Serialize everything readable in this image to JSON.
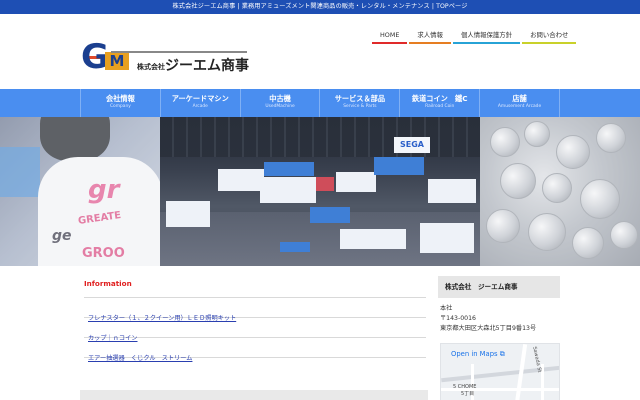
{
  "topbar": {
    "text": "株式会社ジーエム商事 | 業務用アミューズメント関連商品の販売・レンタル・メンテナンス | TOPページ"
  },
  "logo": {
    "mark": "GM",
    "company_prefix": "株式会社",
    "company_name": "ジーエム商事"
  },
  "topnav": [
    {
      "label": "HOME"
    },
    {
      "label": "求人情報"
    },
    {
      "label": "個人情報保護方針"
    },
    {
      "label": "お問い合わせ"
    }
  ],
  "mainnav": [
    {
      "label": "会社情報",
      "sub": "Company"
    },
    {
      "label": "アーケードマシン",
      "sub": "Arcade"
    },
    {
      "label": "中古機",
      "sub": "UsedMachine"
    },
    {
      "label": "サービス＆部品",
      "sub": "Service & Parts"
    },
    {
      "label": "鉄道コイン　鐵C",
      "sub": "Railroad Coin"
    },
    {
      "label": "店舗",
      "sub": "Amusement Arcade"
    }
  ],
  "hero": {
    "shirt_print_1": "gr",
    "shirt_print_2": "GREATE",
    "shirt_print_3": "GROO",
    "booth_sign": "SEGA"
  },
  "information": {
    "title": "Information",
    "items": [
      {
        "label": "フレナスター（１、２クイーン用）ＬＥＤ照明キット"
      },
      {
        "label": "カップ｜ｎコイン"
      },
      {
        "label": "エアー抽選器　くじクル　ストリーム"
      }
    ]
  },
  "sidebar": {
    "title": "株式会社　ジーエム商事",
    "lines": [
      "本社",
      "〒143-0016",
      "東京都大田区大森北5丁目9番13号"
    ],
    "map": {
      "link": "Open in Maps",
      "label_1": "5 CHOME",
      "label_2": "5丁目",
      "street": "Sawada St"
    }
  },
  "colors": {
    "topbar": "#1e4fb4",
    "nav": "#4a8ef0",
    "info_title": "#e02020",
    "link": "#2a3fb0"
  }
}
